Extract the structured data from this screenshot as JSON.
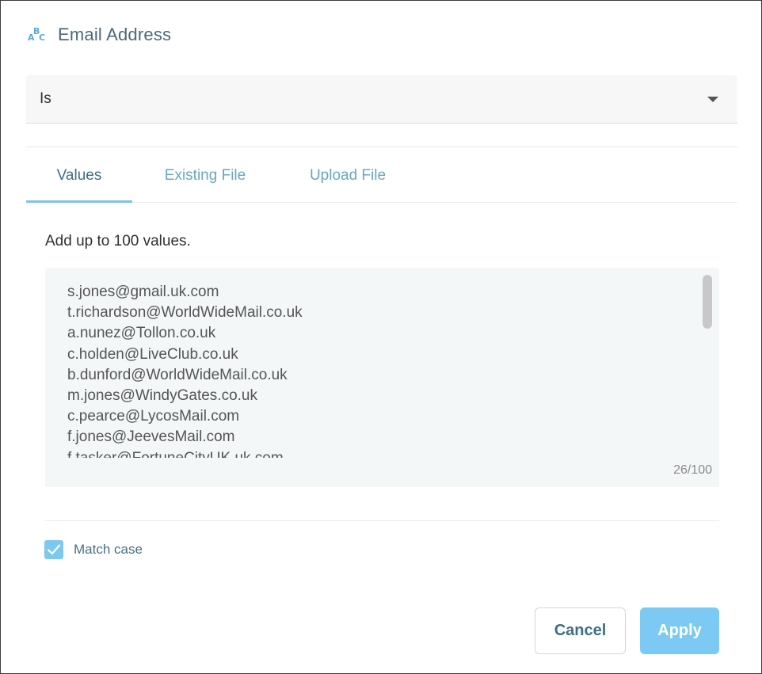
{
  "header": {
    "icon": "abc-text-type-icon",
    "icon_letters": {
      "a": "A",
      "b": "B",
      "c": "C"
    },
    "title": "Email Address"
  },
  "operator": {
    "selected": "Is"
  },
  "tabs": [
    {
      "label": "Values",
      "active": true
    },
    {
      "label": "Existing File",
      "active": false
    },
    {
      "label": "Upload File",
      "active": false
    }
  ],
  "values_panel": {
    "hint": "Add up to 100 values.",
    "lines": [
      "s.jones@gmail.uk.com",
      "t.richardson@WorldWideMail.co.uk",
      "a.nunez@Tollon.co.uk",
      "c.holden@LiveClub.co.uk",
      "b.dunford@WorldWideMail.co.uk",
      "m.jones@WindyGates.co.uk",
      "c.pearce@LycosMail.com",
      "f.jones@JeevesMail.com",
      "f.tasker@FortuneCityUK.uk.com"
    ],
    "counter": "26/100"
  },
  "match_case": {
    "label": "Match case",
    "checked": true
  },
  "buttons": {
    "cancel": "Cancel",
    "apply": "Apply"
  },
  "colors": {
    "accent": "#7cc4e6",
    "title": "#4b6978",
    "apply_bg": "#7ccaf3"
  }
}
